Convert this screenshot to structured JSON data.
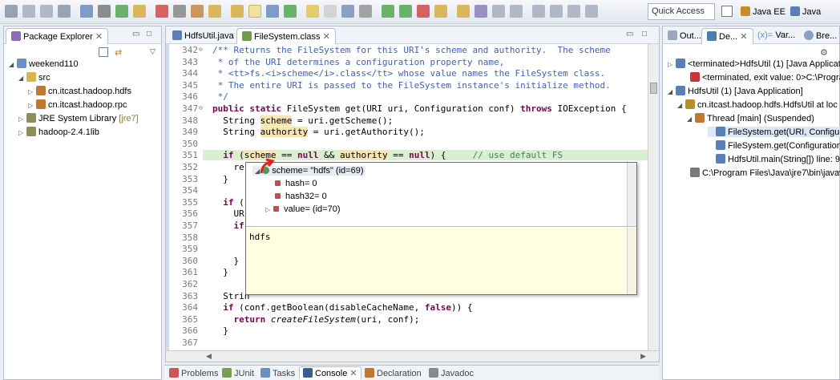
{
  "toolbar": {
    "quick_access": "Quick Access",
    "perspectives": [
      "Java EE",
      "Java"
    ]
  },
  "package_explorer": {
    "tab_label": "Package Explorer",
    "items": [
      {
        "label": "weekend110"
      },
      {
        "label": "src"
      },
      {
        "label": "cn.itcast.hadoop.hdfs"
      },
      {
        "label": "cn.itcast.hadoop.rpc"
      },
      {
        "label": "JRE System Library",
        "suffix": "[jre7]"
      },
      {
        "label": "hadoop-2.4.1lib"
      }
    ]
  },
  "editor": {
    "tabs": [
      "HdfsUtil.java",
      "FileSystem.class"
    ],
    "lines": [
      {
        "n": "342",
        "text": "/** Returns the FileSystem for this URI's scheme and authority.  The scheme"
      },
      {
        "n": "343",
        "text": " * of the URI determines a configuration property name,"
      },
      {
        "n": "344",
        "text": " * <tt>fs.<i>scheme</i>.class</tt> whose value names the FileSystem class."
      },
      {
        "n": "345",
        "text": " * The entire URI is passed to the FileSystem instance's initialize method."
      },
      {
        "n": "346",
        "text": " */"
      },
      {
        "n": "347",
        "text": "public static FileSystem get(URI uri, Configuration conf) throws IOException {"
      },
      {
        "n": "348",
        "text": "  String scheme = uri.getScheme();"
      },
      {
        "n": "349",
        "text": "  String authority = uri.getAuthority();"
      },
      {
        "n": "350",
        "text": ""
      },
      {
        "n": "351",
        "text": "  if (scheme == null && authority == null) {     // use default FS"
      },
      {
        "n": "352",
        "text": "    re"
      },
      {
        "n": "353",
        "text": "  }"
      },
      {
        "n": "354",
        "text": ""
      },
      {
        "n": "355",
        "text": "  if ("
      },
      {
        "n": "356",
        "text": "    UR"
      },
      {
        "n": "357",
        "text": "    if"
      },
      {
        "n": "358",
        "text": ""
      },
      {
        "n": "359",
        "text": ""
      },
      {
        "n": "360",
        "text": "    }"
      },
      {
        "n": "361",
        "text": "  }"
      },
      {
        "n": "362",
        "text": ""
      },
      {
        "n": "363",
        "text": "  Strin"
      },
      {
        "n": "364",
        "text": "  if (conf.getBoolean(disableCacheName, false)) {"
      },
      {
        "n": "365",
        "text": "    return createFileSystem(uri, conf);"
      },
      {
        "n": "366",
        "text": "  }"
      },
      {
        "n": "367",
        "text": ""
      }
    ]
  },
  "hover_popup": {
    "root": "scheme= \"hdfs\" (id=69)",
    "children": [
      "hash= 0",
      "hash32= 0",
      "value= (id=70)"
    ],
    "detail": "hdfs"
  },
  "debug": {
    "tabs": [
      "Out...",
      "De...",
      "Var...",
      "Bre..."
    ],
    "items": [
      "<terminated>HdfsUtil (1) [Java Applicati",
      "<terminated, exit value: 0>C:\\Progra",
      "HdfsUtil (1) [Java Application]",
      "cn.itcast.hadoop.hdfs.HdfsUtil at loc",
      "Thread [main] (Suspended)",
      "FileSystem.get(URI, Configura",
      "FileSystem.get(Configuration)",
      "HdfsUtil.main(String[]) line: 96",
      "C:\\Program Files\\Java\\jre7\\bin\\javaw"
    ]
  },
  "bottom_tabs": [
    "Problems",
    "JUnit",
    "Tasks",
    "Console",
    "Declaration",
    "Javadoc"
  ]
}
